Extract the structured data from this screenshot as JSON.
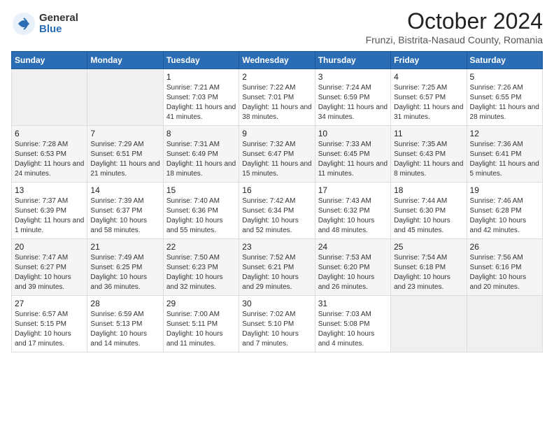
{
  "logo": {
    "general": "General",
    "blue": "Blue"
  },
  "header": {
    "month": "October 2024",
    "subtitle": "Frunzi, Bistrita-Nasaud County, Romania"
  },
  "weekdays": [
    "Sunday",
    "Monday",
    "Tuesday",
    "Wednesday",
    "Thursday",
    "Friday",
    "Saturday"
  ],
  "weeks": [
    [
      {
        "day": "",
        "info": ""
      },
      {
        "day": "",
        "info": ""
      },
      {
        "day": "1",
        "info": "Sunrise: 7:21 AM\nSunset: 7:03 PM\nDaylight: 11 hours and 41 minutes."
      },
      {
        "day": "2",
        "info": "Sunrise: 7:22 AM\nSunset: 7:01 PM\nDaylight: 11 hours and 38 minutes."
      },
      {
        "day": "3",
        "info": "Sunrise: 7:24 AM\nSunset: 6:59 PM\nDaylight: 11 hours and 34 minutes."
      },
      {
        "day": "4",
        "info": "Sunrise: 7:25 AM\nSunset: 6:57 PM\nDaylight: 11 hours and 31 minutes."
      },
      {
        "day": "5",
        "info": "Sunrise: 7:26 AM\nSunset: 6:55 PM\nDaylight: 11 hours and 28 minutes."
      }
    ],
    [
      {
        "day": "6",
        "info": "Sunrise: 7:28 AM\nSunset: 6:53 PM\nDaylight: 11 hours and 24 minutes."
      },
      {
        "day": "7",
        "info": "Sunrise: 7:29 AM\nSunset: 6:51 PM\nDaylight: 11 hours and 21 minutes."
      },
      {
        "day": "8",
        "info": "Sunrise: 7:31 AM\nSunset: 6:49 PM\nDaylight: 11 hours and 18 minutes."
      },
      {
        "day": "9",
        "info": "Sunrise: 7:32 AM\nSunset: 6:47 PM\nDaylight: 11 hours and 15 minutes."
      },
      {
        "day": "10",
        "info": "Sunrise: 7:33 AM\nSunset: 6:45 PM\nDaylight: 11 hours and 11 minutes."
      },
      {
        "day": "11",
        "info": "Sunrise: 7:35 AM\nSunset: 6:43 PM\nDaylight: 11 hours and 8 minutes."
      },
      {
        "day": "12",
        "info": "Sunrise: 7:36 AM\nSunset: 6:41 PM\nDaylight: 11 hours and 5 minutes."
      }
    ],
    [
      {
        "day": "13",
        "info": "Sunrise: 7:37 AM\nSunset: 6:39 PM\nDaylight: 11 hours and 1 minute."
      },
      {
        "day": "14",
        "info": "Sunrise: 7:39 AM\nSunset: 6:37 PM\nDaylight: 10 hours and 58 minutes."
      },
      {
        "day": "15",
        "info": "Sunrise: 7:40 AM\nSunset: 6:36 PM\nDaylight: 10 hours and 55 minutes."
      },
      {
        "day": "16",
        "info": "Sunrise: 7:42 AM\nSunset: 6:34 PM\nDaylight: 10 hours and 52 minutes."
      },
      {
        "day": "17",
        "info": "Sunrise: 7:43 AM\nSunset: 6:32 PM\nDaylight: 10 hours and 48 minutes."
      },
      {
        "day": "18",
        "info": "Sunrise: 7:44 AM\nSunset: 6:30 PM\nDaylight: 10 hours and 45 minutes."
      },
      {
        "day": "19",
        "info": "Sunrise: 7:46 AM\nSunset: 6:28 PM\nDaylight: 10 hours and 42 minutes."
      }
    ],
    [
      {
        "day": "20",
        "info": "Sunrise: 7:47 AM\nSunset: 6:27 PM\nDaylight: 10 hours and 39 minutes."
      },
      {
        "day": "21",
        "info": "Sunrise: 7:49 AM\nSunset: 6:25 PM\nDaylight: 10 hours and 36 minutes."
      },
      {
        "day": "22",
        "info": "Sunrise: 7:50 AM\nSunset: 6:23 PM\nDaylight: 10 hours and 32 minutes."
      },
      {
        "day": "23",
        "info": "Sunrise: 7:52 AM\nSunset: 6:21 PM\nDaylight: 10 hours and 29 minutes."
      },
      {
        "day": "24",
        "info": "Sunrise: 7:53 AM\nSunset: 6:20 PM\nDaylight: 10 hours and 26 minutes."
      },
      {
        "day": "25",
        "info": "Sunrise: 7:54 AM\nSunset: 6:18 PM\nDaylight: 10 hours and 23 minutes."
      },
      {
        "day": "26",
        "info": "Sunrise: 7:56 AM\nSunset: 6:16 PM\nDaylight: 10 hours and 20 minutes."
      }
    ],
    [
      {
        "day": "27",
        "info": "Sunrise: 6:57 AM\nSunset: 5:15 PM\nDaylight: 10 hours and 17 minutes."
      },
      {
        "day": "28",
        "info": "Sunrise: 6:59 AM\nSunset: 5:13 PM\nDaylight: 10 hours and 14 minutes."
      },
      {
        "day": "29",
        "info": "Sunrise: 7:00 AM\nSunset: 5:11 PM\nDaylight: 10 hours and 11 minutes."
      },
      {
        "day": "30",
        "info": "Sunrise: 7:02 AM\nSunset: 5:10 PM\nDaylight: 10 hours and 7 minutes."
      },
      {
        "day": "31",
        "info": "Sunrise: 7:03 AM\nSunset: 5:08 PM\nDaylight: 10 hours and 4 minutes."
      },
      {
        "day": "",
        "info": ""
      },
      {
        "day": "",
        "info": ""
      }
    ]
  ]
}
